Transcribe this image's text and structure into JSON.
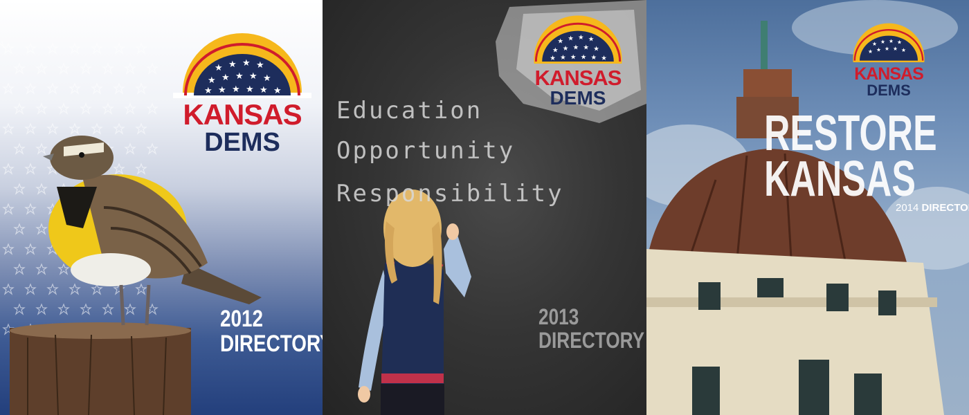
{
  "panels": [
    {
      "logo": {
        "line1": "KANSAS",
        "line2": "DEMS"
      },
      "directory": {
        "year": "2012",
        "label": "DIRECTORY"
      }
    },
    {
      "logo": {
        "line1": "KANSAS",
        "line2": "DEMS"
      },
      "chalk_words": [
        "Education",
        "Opportunity",
        "Responsibility"
      ],
      "directory": {
        "year": "2013",
        "label": "DIRECTORY"
      }
    },
    {
      "logo": {
        "line1": "KANSAS",
        "line2": "DEMS"
      },
      "headline": {
        "line1": "RESTORE",
        "line2": "KANSAS"
      },
      "directory": {
        "year": "2014",
        "label": "DIRECTORY"
      }
    }
  ],
  "colors": {
    "kansas_red": "#d01c2c",
    "dems_navy": "#1d2d5c",
    "sun_yellow": "#f6b81c"
  }
}
